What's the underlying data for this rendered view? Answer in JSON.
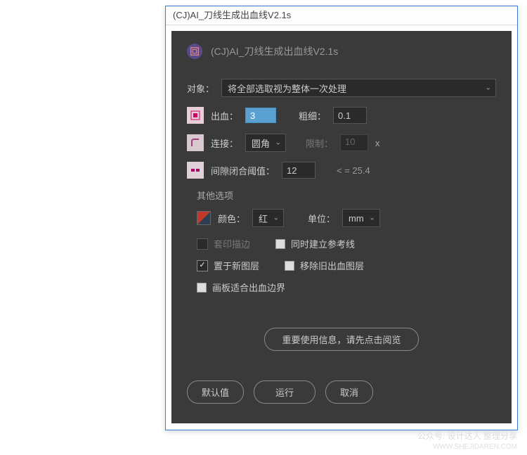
{
  "window": {
    "title": "(CJ)AI_刀线生成出血线V2.1s"
  },
  "header": {
    "title": "(CJ)AI_刀线生成出血线V2.1s"
  },
  "target": {
    "label": "对象：",
    "selected": "将全部选取视为整体一次处理"
  },
  "bleed": {
    "label": "出血：",
    "value": "3",
    "weight_label": "粗细：",
    "weight_value": "0.1"
  },
  "join": {
    "label": "连接：",
    "selected": "圆角",
    "limit_label": "限制：",
    "limit_value": "10",
    "unit": "x"
  },
  "gap": {
    "label": "间隙闭合阈值：",
    "value": "12",
    "hint": "< = 25.4"
  },
  "options": {
    "section_label": "其他选项",
    "color_label": "颜色：",
    "color_selected": "红",
    "unit_label": "单位：",
    "unit_selected": "mm",
    "print_marks": {
      "label": "套印描边",
      "checked": false,
      "disabled": true
    },
    "guides": {
      "label": "同时建立参考线",
      "checked": false
    },
    "new_layer": {
      "label": "置于新图层",
      "checked": true
    },
    "remove_old": {
      "label": "移除旧出血图层",
      "checked": false
    },
    "artboard_fit": {
      "label": "画板适合出血边界",
      "checked": false
    }
  },
  "info_button": "重要使用信息，请先点击阅览",
  "buttons": {
    "default": "默认值",
    "run": "运行",
    "cancel": "取消"
  },
  "watermark": {
    "line1": "公众号: 设计达人 整理分享",
    "line2": "WWW.SHEJIDAREN.COM"
  }
}
